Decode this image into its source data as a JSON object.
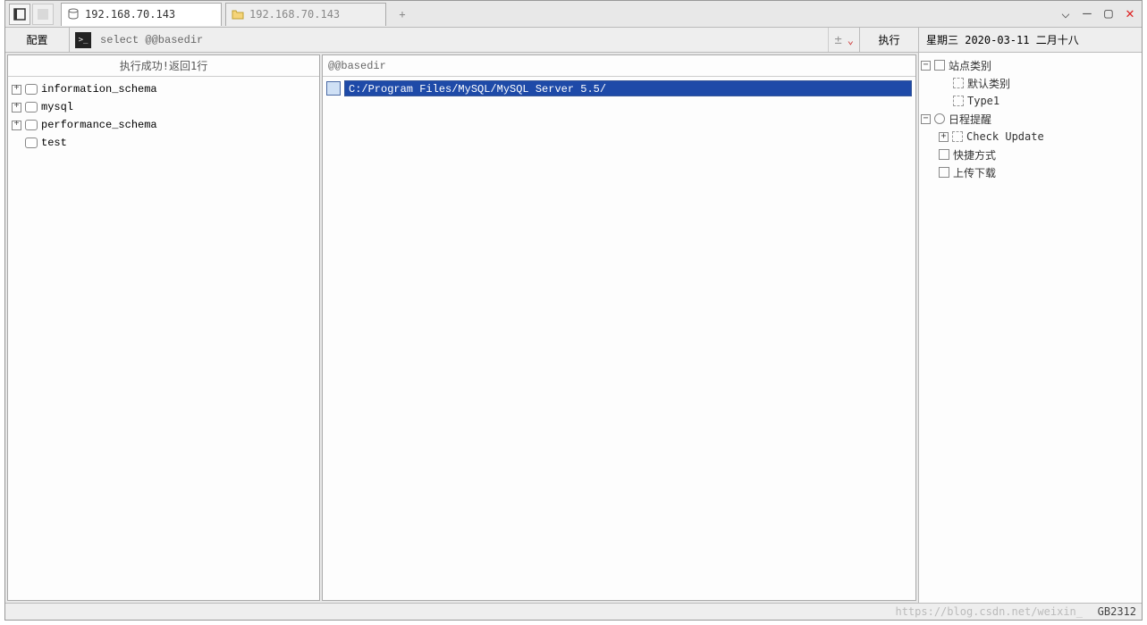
{
  "tabs": {
    "active": {
      "label": "192.168.70.143"
    },
    "inactive": {
      "label": "192.168.70.143"
    }
  },
  "cmd": {
    "config_label": "配置",
    "input_value": "select @@basedir",
    "exec_label": "执行"
  },
  "left": {
    "status": "执行成功!返回1行",
    "items": [
      {
        "label": "information_schema",
        "expandable": true
      },
      {
        "label": "mysql",
        "expandable": true
      },
      {
        "label": "performance_schema",
        "expandable": true
      },
      {
        "label": "test",
        "expandable": false
      }
    ]
  },
  "center": {
    "column_header": "@@basedir",
    "row_value": "C:/Program Files/MySQL/MySQL Server 5.5/"
  },
  "right": {
    "date_text": "星期三 2020-03-11 二月十八",
    "tree": {
      "site_category": "站点类别",
      "default_category": "默认类别",
      "type1": "Type1",
      "schedule": "日程提醒",
      "check_update": "Check Update",
      "shortcut": "快捷方式",
      "upload_download": "上传下载"
    }
  },
  "status": {
    "encoding": "GB2312"
  },
  "watermark": "https://blog.csdn.net/weixin_"
}
